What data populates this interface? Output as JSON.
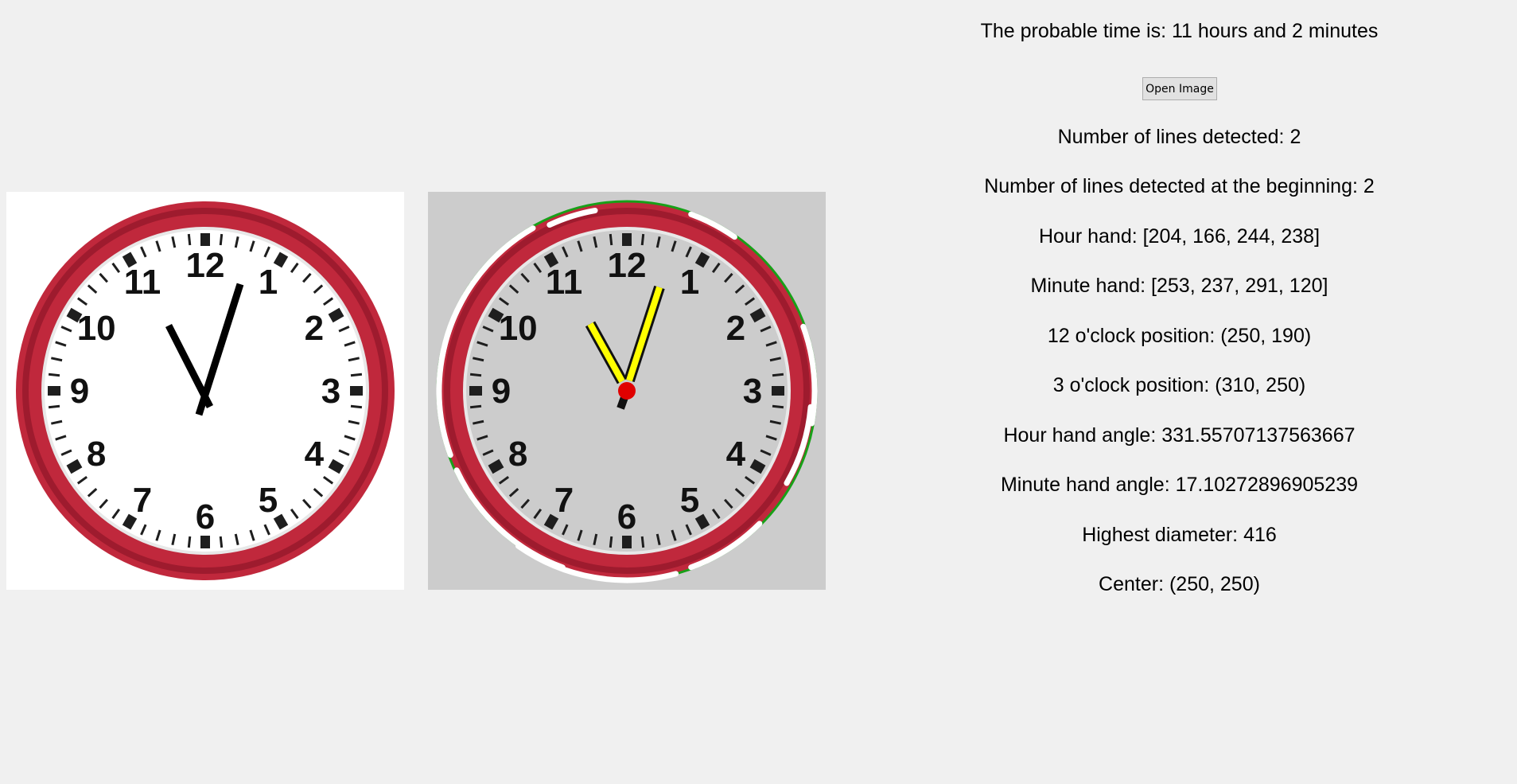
{
  "result": {
    "probable_time": "The probable time is: 11 hours and 2 minutes"
  },
  "controls": {
    "open_image_label": "Open Image"
  },
  "details": [
    "Number of lines detected: 2",
    "Number of lines detected at the beginning: 2",
    "Hour hand: [204, 166, 244, 238]",
    "Minute hand: [253, 237, 291, 120]",
    "12 o'clock position: (250, 190)",
    "3 o'clock position: (310, 250)",
    "Hour hand angle: 331.55707137563667",
    "Minute hand angle: 17.10272896905239",
    "Highest diameter: 416",
    "Center: (250, 250)"
  ],
  "clock": {
    "numerals": [
      "12",
      "1",
      "2",
      "3",
      "4",
      "5",
      "6",
      "7",
      "8",
      "9",
      "10",
      "11"
    ]
  },
  "colors": {
    "rim": "#c0283c",
    "rim_dark": "#9e1b2e",
    "detected_hand": "#ffff00",
    "detected_center": "#e00000",
    "detected_circle": "#18a018"
  }
}
